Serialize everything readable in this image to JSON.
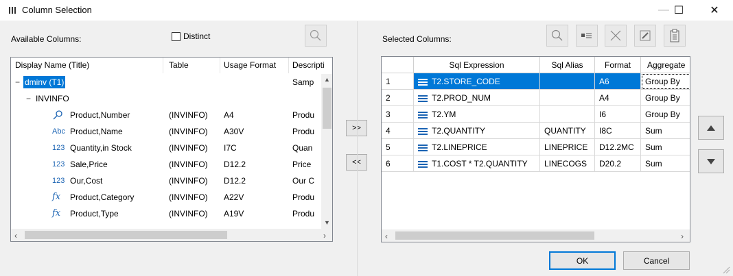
{
  "window": {
    "title": "Column Selection",
    "minimize_glyph": "—",
    "maximize_glyph": "☐",
    "close_glyph": "✕"
  },
  "left": {
    "available_label": "Available Columns:",
    "distinct_label": "Distinct",
    "distinct_checked": false,
    "columns": [
      "Display Name (Title)",
      "Table",
      "Usage Format",
      "Descripti"
    ],
    "tree": [
      {
        "name": "dminv (T1)",
        "table": "",
        "format": "",
        "desc": "Samp",
        "level": 0,
        "icon": "collapse",
        "selected": true
      },
      {
        "name": "INVINFO",
        "table": "",
        "format": "",
        "desc": "",
        "level": 1,
        "icon": "collapse"
      },
      {
        "name": "Product,Number",
        "table": "(INVINFO)",
        "format": "A4",
        "desc": "Produ",
        "level": 2,
        "icon": "key-icon"
      },
      {
        "name": "Product,Name",
        "table": "(INVINFO)",
        "format": "A30V",
        "desc": "Produ",
        "level": 2,
        "icon": "abc-icon"
      },
      {
        "name": "Quantity,in Stock",
        "table": "(INVINFO)",
        "format": "I7C",
        "desc": "Quan",
        "level": 2,
        "icon": "numeric-icon"
      },
      {
        "name": "Sale,Price",
        "table": "(INVINFO)",
        "format": "D12.2",
        "desc": "Price",
        "level": 2,
        "icon": "numeric-icon"
      },
      {
        "name": "Our,Cost",
        "table": "(INVINFO)",
        "format": "D12.2",
        "desc": "Our C",
        "level": 2,
        "icon": "numeric-icon"
      },
      {
        "name": "Product,Category",
        "table": "(INVINFO)",
        "format": "A22V",
        "desc": "Produ",
        "level": 2,
        "icon": "function-icon"
      },
      {
        "name": "Product,Type",
        "table": "(INVINFO)",
        "format": "A19V",
        "desc": "Produ",
        "level": 2,
        "icon": "function-icon"
      }
    ],
    "icon_glyphs": {
      "abc": "Abc",
      "num": "123",
      "fx": "fx"
    }
  },
  "middle": {
    "add_label": ">>",
    "remove_label": "<<"
  },
  "right": {
    "selected_label": "Selected Columns:",
    "columns": [
      "Sql Expression",
      "Sql Alias",
      "Format",
      "Aggregate"
    ],
    "rows": [
      {
        "num": "1",
        "expr": "T2.STORE_CODE",
        "alias": "",
        "format": "A6",
        "agg": "Group By",
        "selected": true
      },
      {
        "num": "2",
        "expr": "T2.PROD_NUM",
        "alias": "",
        "format": "A4",
        "agg": "Group By"
      },
      {
        "num": "3",
        "expr": "T2.YM",
        "alias": "",
        "format": "I6",
        "agg": "Group By"
      },
      {
        "num": "4",
        "expr": "T2.QUANTITY",
        "alias": "QUANTITY",
        "format": "I8C",
        "agg": "Sum"
      },
      {
        "num": "5",
        "expr": "T2.LINEPRICE",
        "alias": "LINEPRICE",
        "format": "D12.2MC",
        "agg": "Sum"
      },
      {
        "num": "6",
        "expr": "T1.COST * T2.QUANTITY",
        "alias": "LINECOGS",
        "format": "D20.2",
        "agg": "Sum"
      }
    ]
  },
  "footer": {
    "ok_label": "OK",
    "cancel_label": "Cancel"
  },
  "colors": {
    "selection": "#0078d7",
    "row_icon": "#1a63b3"
  }
}
